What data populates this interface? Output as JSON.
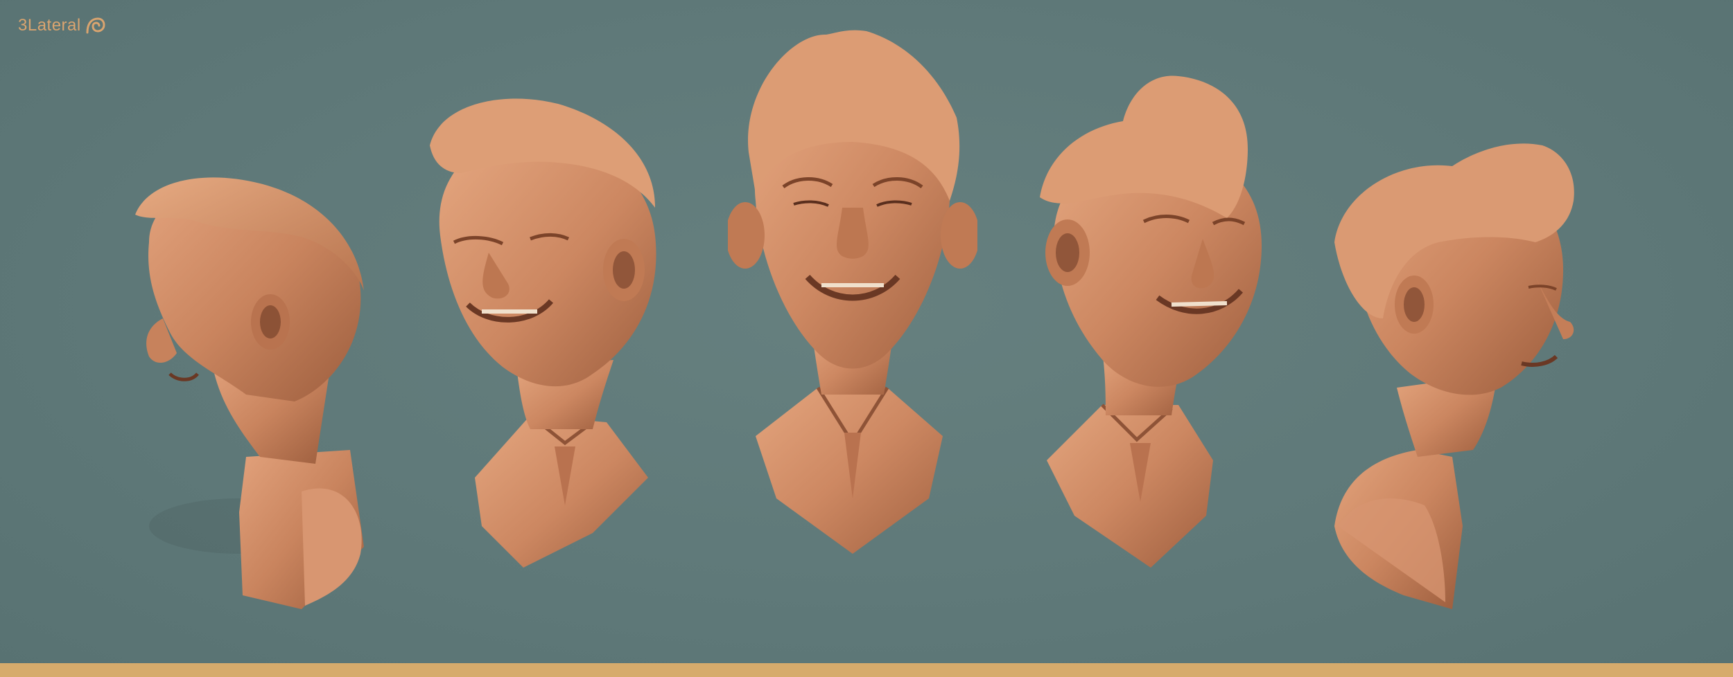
{
  "brand": {
    "logo_text": "3Lateral"
  },
  "scene": {
    "background_color": "#5f7a7a",
    "footer_bar_color": "#d6ab6c",
    "clay_color": "#cf8c67",
    "views": [
      {
        "name": "left-profile"
      },
      {
        "name": "left-three-quarter"
      },
      {
        "name": "front"
      },
      {
        "name": "right-three-quarter"
      },
      {
        "name": "right-profile"
      }
    ]
  }
}
